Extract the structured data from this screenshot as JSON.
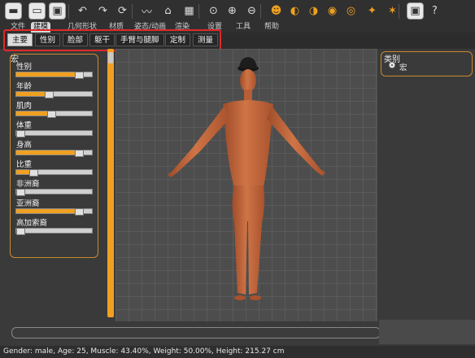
{
  "toolbar": {
    "buttons": [
      {
        "name": "toggle-view-icon"
      },
      {
        "name": "open-folder-icon"
      },
      {
        "name": "save-icon"
      },
      {
        "name": "undo-icon"
      },
      {
        "name": "redo-icon"
      },
      {
        "name": "reset-icon"
      },
      {
        "name": "wireframe-icon"
      },
      {
        "name": "mesh-icon"
      },
      {
        "name": "checker-icon"
      },
      {
        "name": "zoom-fit-icon"
      },
      {
        "name": "zoom-in-icon"
      },
      {
        "name": "zoom-out-icon"
      },
      {
        "name": "front-view-icon"
      },
      {
        "name": "side-view-icon"
      },
      {
        "name": "back-view-icon"
      },
      {
        "name": "top-view-icon"
      },
      {
        "name": "bottom-view-icon"
      },
      {
        "name": "symmetry-icon"
      },
      {
        "name": "pose-icon"
      },
      {
        "name": "screenshot-icon"
      },
      {
        "name": "help-icon",
        "glyph": "?"
      }
    ]
  },
  "menu": {
    "items": [
      "文件",
      "建模",
      "几何形状",
      "材质",
      "姿态/动画",
      "渲染",
      "设置",
      "工具",
      "帮助"
    ],
    "active_index": 1
  },
  "subtabs": {
    "items": [
      "主要",
      "性别",
      "脸部",
      "躯干",
      "手臂与腿脚",
      "定制",
      "测量"
    ],
    "active_index": 0
  },
  "left_panel": {
    "title": "宏",
    "sliders": [
      {
        "label": "性别",
        "value": 0.88
      },
      {
        "label": "年龄",
        "value": 0.43
      },
      {
        "label": "肌肉",
        "value": 0.46
      },
      {
        "label": "体重",
        "value": 0.0
      },
      {
        "label": "身高",
        "value": 0.88
      },
      {
        "label": "比重",
        "value": 0.2
      },
      {
        "label": "非洲裔",
        "value": 0.0
      },
      {
        "label": "亚洲裔",
        "value": 0.88
      },
      {
        "label": "高加索裔",
        "value": 0.0
      }
    ]
  },
  "right_panel": {
    "title": "类别",
    "option_label": "宏"
  },
  "status": {
    "text": "Gender: male, Age: 25, Muscle: 43.40%, Weight: 50.00%, Height: 215.27 cm"
  },
  "colors": {
    "accent": "#f0a020",
    "highlight_box": "#e02828",
    "skin": "#c76a3e"
  }
}
